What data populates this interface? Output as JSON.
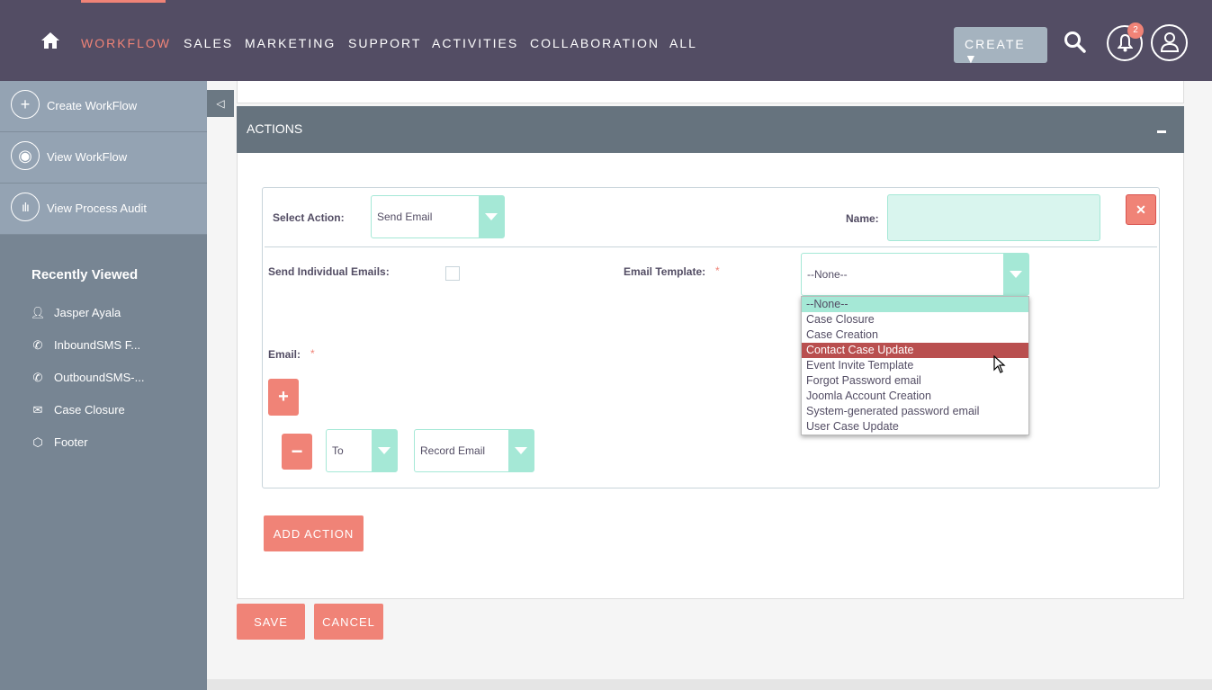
{
  "header": {
    "nav": [
      "WORKFLOW",
      "SALES",
      "MARKETING",
      "SUPPORT",
      "ACTIVITIES",
      "COLLABORATION",
      "ALL"
    ],
    "active": "WORKFLOW",
    "create_label": "CREATE",
    "notification_count": "2",
    "accent": "#f08377",
    "bg": "#534d64"
  },
  "sidebar": {
    "actions": [
      {
        "label": "Create WorkFlow",
        "icon": "plus-icon"
      },
      {
        "label": "View WorkFlow",
        "icon": "eye-icon"
      },
      {
        "label": "View Process Audit",
        "icon": "audit-icon"
      }
    ],
    "recently_viewed_title": "Recently Viewed",
    "recent": [
      {
        "label": "Jasper Ayala",
        "icon": "user-icon"
      },
      {
        "label": "InboundSMS F...",
        "icon": "phone-icon"
      },
      {
        "label": "OutboundSMS-...",
        "icon": "phone-icon"
      },
      {
        "label": "Case Closure",
        "icon": "email-template-icon"
      },
      {
        "label": "Footer",
        "icon": "cube-icon"
      }
    ]
  },
  "actions_panel": {
    "title": "ACTIONS",
    "select_action_label": "Select Action:",
    "select_action_value": "Send Email",
    "name_label": "Name:",
    "name_value": "",
    "send_individual_label": "Send Individual Emails:",
    "send_individual_checked": false,
    "email_template_label": "Email Template:",
    "email_template_value": "--None--",
    "required_mark": "*",
    "email_label": "Email:",
    "to_value": "To",
    "record_email_value": "Record Email",
    "add_action_label": "ADD ACTION",
    "template_options": [
      "--None--",
      "Case Closure",
      "Case Creation",
      "Contact Case Update",
      "Event Invite Template",
      "Forgot Password email",
      "Joomla Account Creation",
      "System-generated password email",
      "User Case Update"
    ],
    "highlighted_option": "Contact Case Update"
  },
  "footer": {
    "save_label": "SAVE",
    "cancel_label": "CANCEL"
  }
}
